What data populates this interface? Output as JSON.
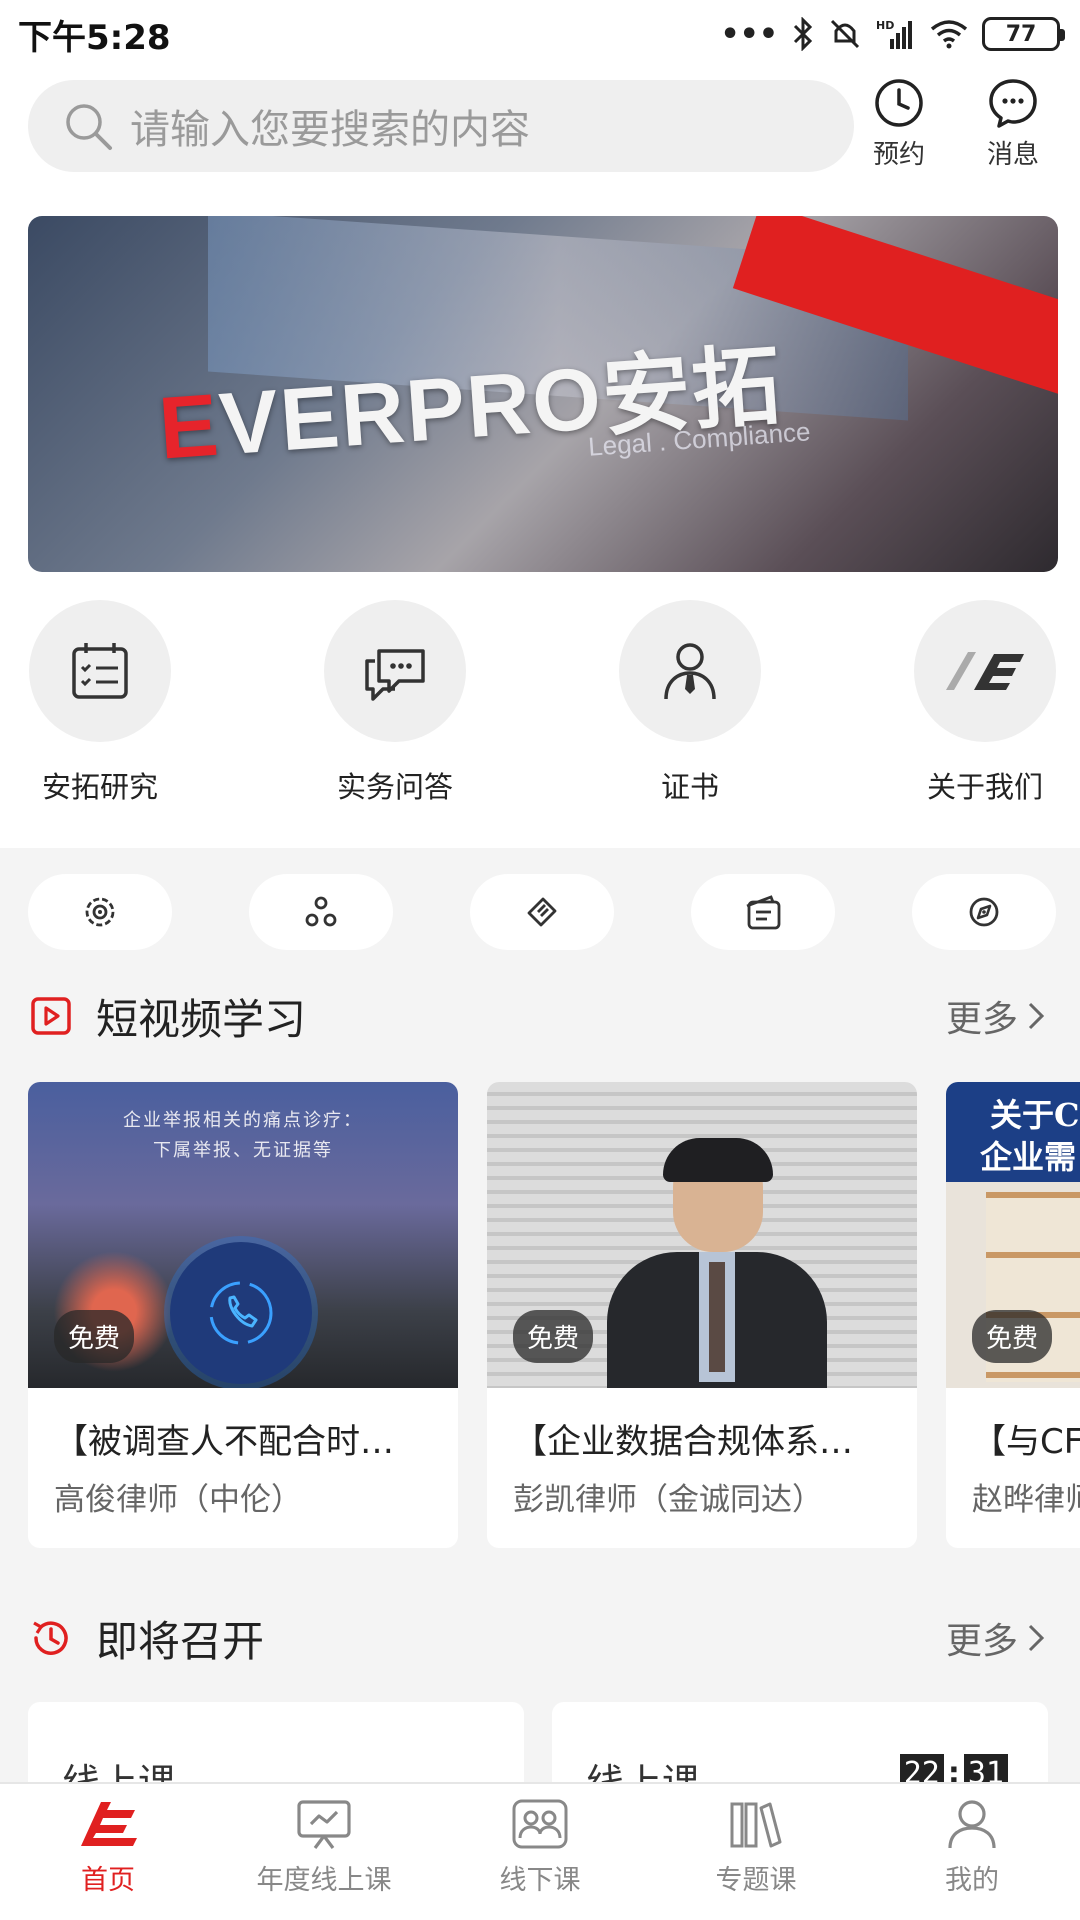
{
  "status_bar": {
    "time": "下午5:28",
    "battery": "77"
  },
  "header": {
    "search_placeholder": "请输入您要搜索的内容",
    "appointment_label": "预约",
    "messages_label": "消息"
  },
  "banner": {
    "brand": "VERPRO安拓",
    "brand_initial": "E",
    "tagline": "Legal . Compliance"
  },
  "quick_links": [
    {
      "label": "安拓研究",
      "icon": "calendar-checklist-icon"
    },
    {
      "label": "实务问答",
      "icon": "chat-bubbles-icon"
    },
    {
      "label": "证书",
      "icon": "person-tie-icon"
    },
    {
      "label": "关于我们",
      "icon": "everpro-logo-icon"
    }
  ],
  "pills": [
    {
      "icon": "target-icon"
    },
    {
      "icon": "triangle-nodes-icon"
    },
    {
      "icon": "ticket-icon"
    },
    {
      "icon": "notebook-icon"
    },
    {
      "icon": "compass-icon"
    }
  ],
  "short_video": {
    "title": "短视频学习",
    "more_label": "更多",
    "cards": [
      {
        "badge": "免费",
        "thumb_line1": "企业举报相关的痛点诊疗：",
        "thumb_line2": "下属举报、无证据等",
        "title": "【被调查人不配合时…",
        "subtitle": "高俊律师（中伦）"
      },
      {
        "badge": "免费",
        "title": "【企业数据合规体系…",
        "subtitle": "彭凯律师（金诚同达）"
      },
      {
        "badge": "免费",
        "thumb_line1": "关于C",
        "thumb_line2": "企业需",
        "title": "【与CF",
        "subtitle": "赵晔律师"
      }
    ]
  },
  "upcoming": {
    "title": "即将召开",
    "more_label": "更多",
    "cards": [
      {
        "type": "线上课"
      },
      {
        "type": "线上课",
        "timer_h": "22",
        "timer_sep": ":",
        "timer_m": "31"
      }
    ]
  },
  "bottom_nav": [
    {
      "label": "首页",
      "active": true
    },
    {
      "label": "年度线上课"
    },
    {
      "label": "线下课"
    },
    {
      "label": "专题课"
    },
    {
      "label": "我的"
    }
  ],
  "colors": {
    "accent": "#e02020",
    "background": "#f4f4f4"
  }
}
